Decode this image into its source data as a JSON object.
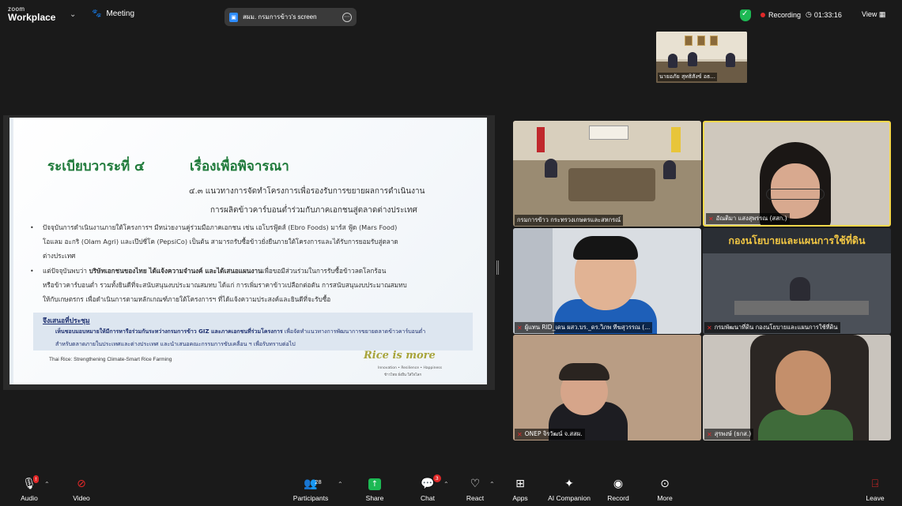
{
  "topbar": {
    "brand_line1": "zoom",
    "brand_line2": "Workplace",
    "meeting_label": "Meeting",
    "share_title": "สผม. กรมการข้าว's screen",
    "recording_label": "Recording",
    "timer": "01:33:16",
    "view_label": "View"
  },
  "self_view": {
    "caption": "นายอภัย สุทธิสังข์ อธ..."
  },
  "slide": {
    "agenda": "ระเบียบวาระที่ ๔",
    "title": "เรื่องเพื่อพิจารณา",
    "subtitle_line1": "๔.๓  แนวทางการจัดทำโครงการเพื่อรองรับการขยายผลการดำเนินงาน",
    "subtitle_line2": "การผลิตข้าวคาร์บอนต่ำร่วมกับภาคเอกชนสู่ตลาดต่างประเทศ",
    "bullet1_line1": "ปัจจุบันการดำเนินงานภายใต้โครงการฯ มีหน่วยงานคู่ร่วมมือภาคเอกชน เช่น เอโบรฟู้ดส์ (Ebro Foods) มาร์ส ฟู้ด (Mars Food)",
    "bullet1_line2": "โอแลม อะกริ (Olam Agri) และเป๊ปซี่โค (PepsiCo) เป็นต้น สามารถรับซื้อข้าวยั่งยืนภายใต้โครงการและได้รับการยอมรับสู่ตลาด",
    "bullet1_line3": "ต่างประเทศ",
    "bullet2_line1_plain": "แต่ปัจจุบันพบว่า ",
    "bullet2_line1_bold": "บริษัทเอกชนของไทย ได้แจ้งความจำนงค์ และได้เสนอแผนงาน",
    "bullet2_line1_rest": "เพื่อขอมีส่วนร่วมในการรับซื้อข้าวลดโลกร้อน",
    "bullet2_line2": "หรือข้าวคาร์บอนต่ำ รวมทั้งยินดีที่จะสนับสนุนงบประมาณสมทบ ได้แก่ การเพิ่มราคาข้าวเปลือกต่อตัน การสนับสนุนงบประมาณสมทบ",
    "bullet2_line3": "ให้กับเกษตรกร เพื่อดำเนินการตามหลักเกณฑ์ภายใต้โครงการฯ ที่ได้แจ้งความประสงค์และยินดีที่จะรับซื้อ",
    "proposal_heading": "จึงเสนอที่ประชุม",
    "proposal_line1_bold": "เห็นชอบมอบหมายให้มีการหารือร่วมกันระหว่างกรมการข้าว GIZ และภาคเอกชนที่ร่วมโครงการ",
    "proposal_line1_rest": " เพื่อจัดทำแนวทางการพัฒนาการขยายตลาดข้าวคาร์บอนต่ำ",
    "proposal_line2": "สำหรับตลาดภายในประเทศและต่างประเทศ และนำเสนอคณะกรรมการขับเคลื่อน ฯ เพื่อรับทราบต่อไป",
    "footer": "Thai Rice: Strengthening Climate-Smart Rice Farming",
    "logo": "Rice is more",
    "logo_sub1": "Innovation • Resilience • Happiness",
    "logo_sub2": "ข้าวไทย ยั่งยืน ใส่ใจโลก"
  },
  "participants_tiles": [
    {
      "caption": "กรมการข้าว กระทรวงเกษตรและสหกรณ์",
      "muted": false
    },
    {
      "caption": "อัณติมา แสงสุพรรณ (สสก.)",
      "muted": true
    },
    {
      "caption": "ผู้แทน RID_เดน ผสว.บร._ดร.วิภพ ทีฆสุวรรณ (...",
      "muted": true
    },
    {
      "caption": "กรมพัฒนาที่ดิน กองนโยบายและแผนการใช้ที่ดิน",
      "muted": true,
      "banner": "กองนโยบายและแผนการใช้ที่ดิน"
    },
    {
      "caption": "ONEP จิรวัฒน์ จ.สสผ.",
      "muted": true
    },
    {
      "caption": "สุรพงษ์ (ธกส.)",
      "muted": true
    }
  ],
  "toolbar": {
    "audio": "Audio",
    "video": "Video",
    "participants": "Participants",
    "participants_count": "28",
    "share": "Share",
    "chat": "Chat",
    "chat_badge": "3",
    "react": "React",
    "apps": "Apps",
    "ai_companion": "AI Companion",
    "record": "Record",
    "more": "More",
    "leave": "Leave"
  },
  "colors": {
    "slide_heading_green": "#1f7a3a",
    "active_speaker_border": "#f6d84b",
    "share_green": "#1db954",
    "recording_red": "#e02828"
  }
}
